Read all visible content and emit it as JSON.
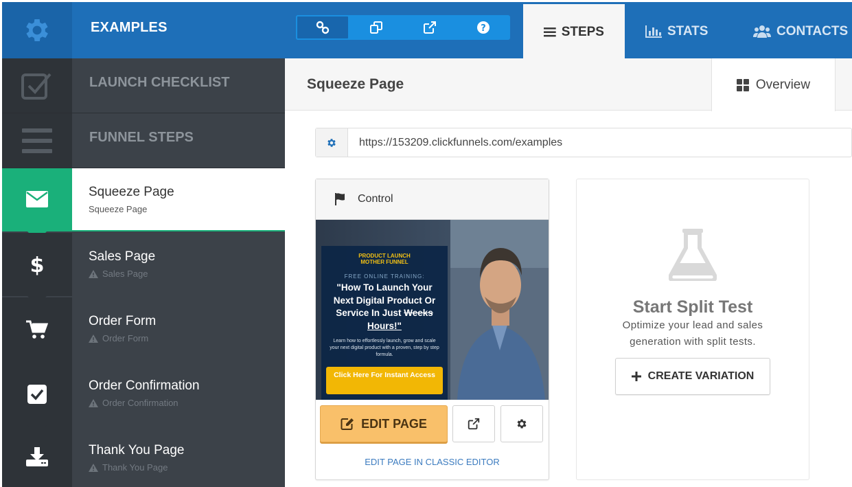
{
  "header": {
    "brand": "EXAMPLES",
    "tools": [
      "link-icon",
      "copy-icon",
      "external-link-icon",
      "help-icon"
    ],
    "tabs": [
      {
        "label": "STEPS",
        "icon": "list-icon",
        "active": true
      },
      {
        "label": "STATS",
        "icon": "bar-chart-icon"
      },
      {
        "label": "CONTACTS",
        "icon": "users-icon"
      }
    ]
  },
  "sidebar": {
    "launch_checklist": "LAUNCH CHECKLIST",
    "funnel_steps": "FUNNEL STEPS",
    "steps": [
      {
        "title": "Squeeze Page",
        "subtitle": "Squeeze Page",
        "icon": "envelope-icon",
        "active": true
      },
      {
        "title": "Sales Page",
        "subtitle": "Sales Page",
        "icon": "dollar-icon"
      },
      {
        "title": "Order Form",
        "subtitle": "Order Form",
        "icon": "cart-icon"
      },
      {
        "title": "Order Confirmation",
        "subtitle": "Order Confirmation",
        "icon": "checkbox-icon"
      },
      {
        "title": "Thank You Page",
        "subtitle": "Thank You Page",
        "icon": "download-icon"
      }
    ]
  },
  "main": {
    "page_title": "Squeeze Page",
    "overview_tab": "Overview",
    "url": "https://153209.clickfunnels.com/examples",
    "control_card": {
      "label": "Control",
      "edit_button": "EDIT PAGE",
      "classic_link": "EDIT PAGE IN CLASSIC EDITOR",
      "preview": {
        "logo_line1": "PRODUCT LAUNCH",
        "logo_line2": "MOTHER FUNNEL",
        "free": "FREE ONLINE TRAINING:",
        "headline_a": "\"How To Launch Your Next Digital Product Or Service In Just",
        "headline_strike": "Weeks",
        "headline_b": "Hours!\"",
        "body": "Learn how to effortlessly launch, grow and scale your next digital product with a proven, step by step formula.",
        "cta": "Click Here For Instant Access"
      }
    },
    "split_test": {
      "title": "Start Split Test",
      "description": "Optimize your lead and sales generation with split tests.",
      "button": "CREATE VARIATION"
    }
  },
  "colors": {
    "topbar": "#1e6fb8",
    "sidebar": "#3c4249",
    "active_step": "#1ab07a",
    "edit_button": "#f9c06a"
  }
}
